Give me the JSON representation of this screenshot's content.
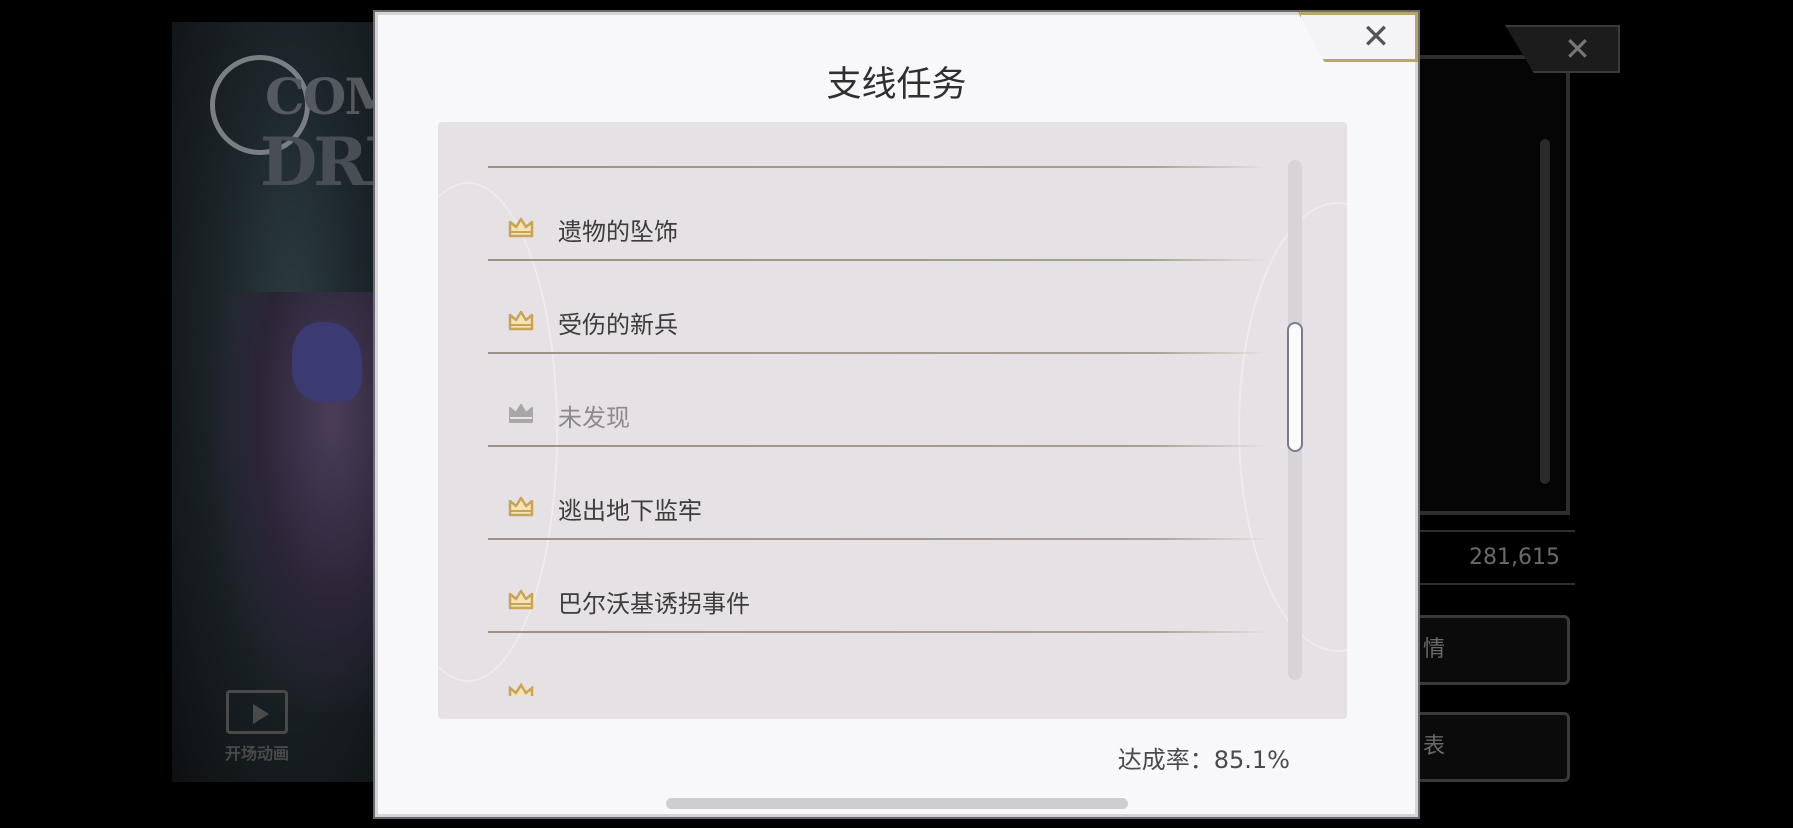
{
  "background": {
    "logo_text_top": "COMP",
    "logo_text_bottom": "DRI",
    "opening_movie_label": "开场动画",
    "right_value": "281,615",
    "right_button_1": "情",
    "right_button_2": "表"
  },
  "dialog": {
    "title": "支线任务",
    "close_glyph": "✕",
    "items": [
      {
        "label": "遗物的坠饰",
        "discovered": true
      },
      {
        "label": "受伤的新兵",
        "discovered": true
      },
      {
        "label": "未发现",
        "discovered": false
      },
      {
        "label": "逃出地下监牢",
        "discovered": true
      },
      {
        "label": "巴尔沃基诱拐事件",
        "discovered": true
      }
    ],
    "completion_text": "达成率：85.1%"
  },
  "colors": {
    "crown_gold": "#c9a457",
    "crown_gray": "#a9a6a8",
    "panel_bg": "#e6e1e4",
    "dialog_bg": "#f8f7fa"
  },
  "icons": [
    "crown-icon",
    "close-icon",
    "film-icon"
  ]
}
